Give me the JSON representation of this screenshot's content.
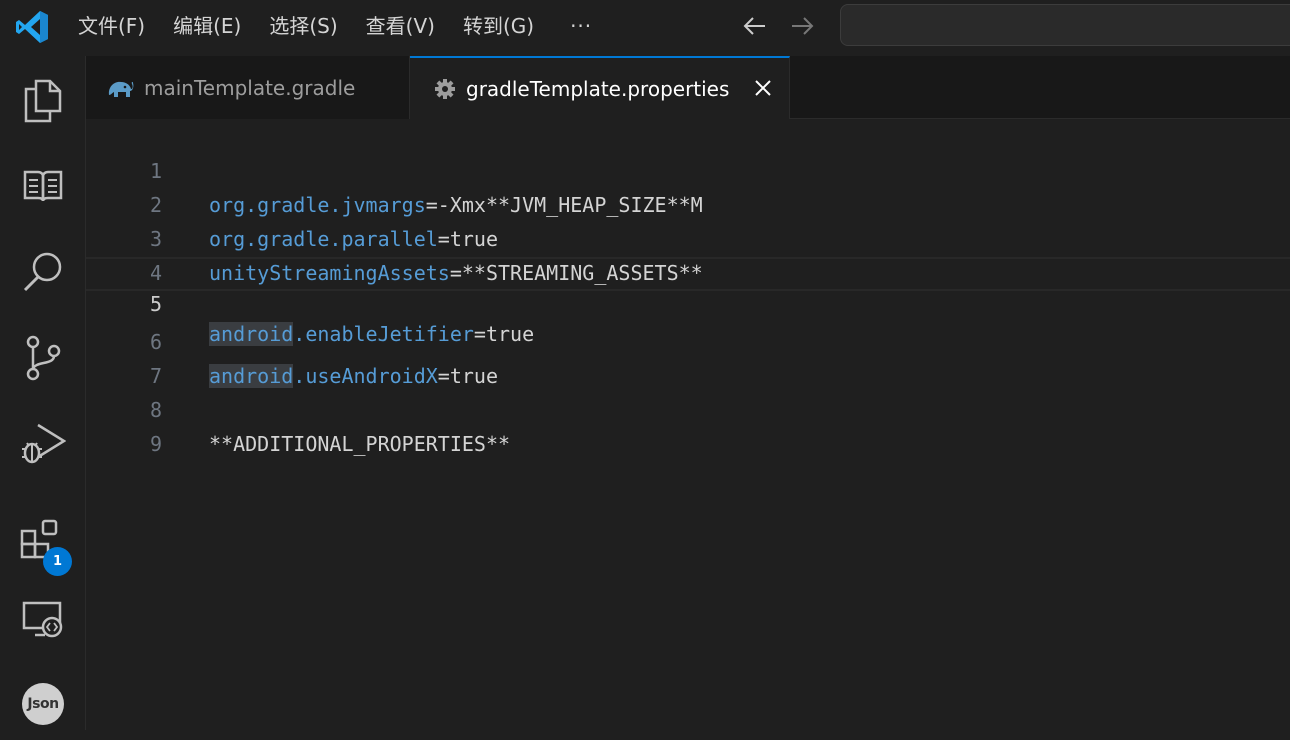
{
  "titlebar": {
    "menu": [
      "文件(F)",
      "编辑(E)",
      "选择(S)",
      "查看(V)",
      "转到(G)"
    ],
    "more": "···"
  },
  "activitybar": {
    "items": [
      "explorer-icon",
      "book-icon",
      "search-icon",
      "source-control-icon",
      "run-debug-icon",
      "extensions-icon",
      "remote-explorer-icon",
      "json-icon"
    ],
    "extensions_badge": "1",
    "json_label": "Json"
  },
  "tabs": [
    {
      "label": "mainTemplate.gradle",
      "icon": "gradle-elephant-icon",
      "active": false
    },
    {
      "label": "gradleTemplate.properties",
      "icon": "gear-icon",
      "active": true
    }
  ],
  "editor": {
    "current_line": 5,
    "lines": [
      {
        "num": "1",
        "key": "org.gradle.jvmargs",
        "rest": "=-Xmx**JVM_HEAP_SIZE**M"
      },
      {
        "num": "2",
        "key": "org.gradle.parallel",
        "rest": "=true"
      },
      {
        "num": "3",
        "key": "unityStreamingAssets",
        "rest": "=**STREAMING_ASSETS**"
      },
      {
        "num": "4",
        "key": "",
        "rest": ""
      },
      {
        "num": "5",
        "key_hl": "android",
        "key": ".enableJetifier",
        "rest": "=true"
      },
      {
        "num": "6",
        "key_hl": "android",
        "key": ".useAndroidX",
        "rest": "=true"
      },
      {
        "num": "7",
        "key": "",
        "rest": ""
      },
      {
        "num": "8",
        "key": "",
        "rest": "**ADDITIONAL_PROPERTIES**"
      },
      {
        "num": "9",
        "key": "",
        "rest": ""
      }
    ]
  },
  "colors": {
    "accent": "#0078d4",
    "keyword": "#569cd6",
    "text": "#d4d4d4",
    "background": "#1f1f1f"
  }
}
